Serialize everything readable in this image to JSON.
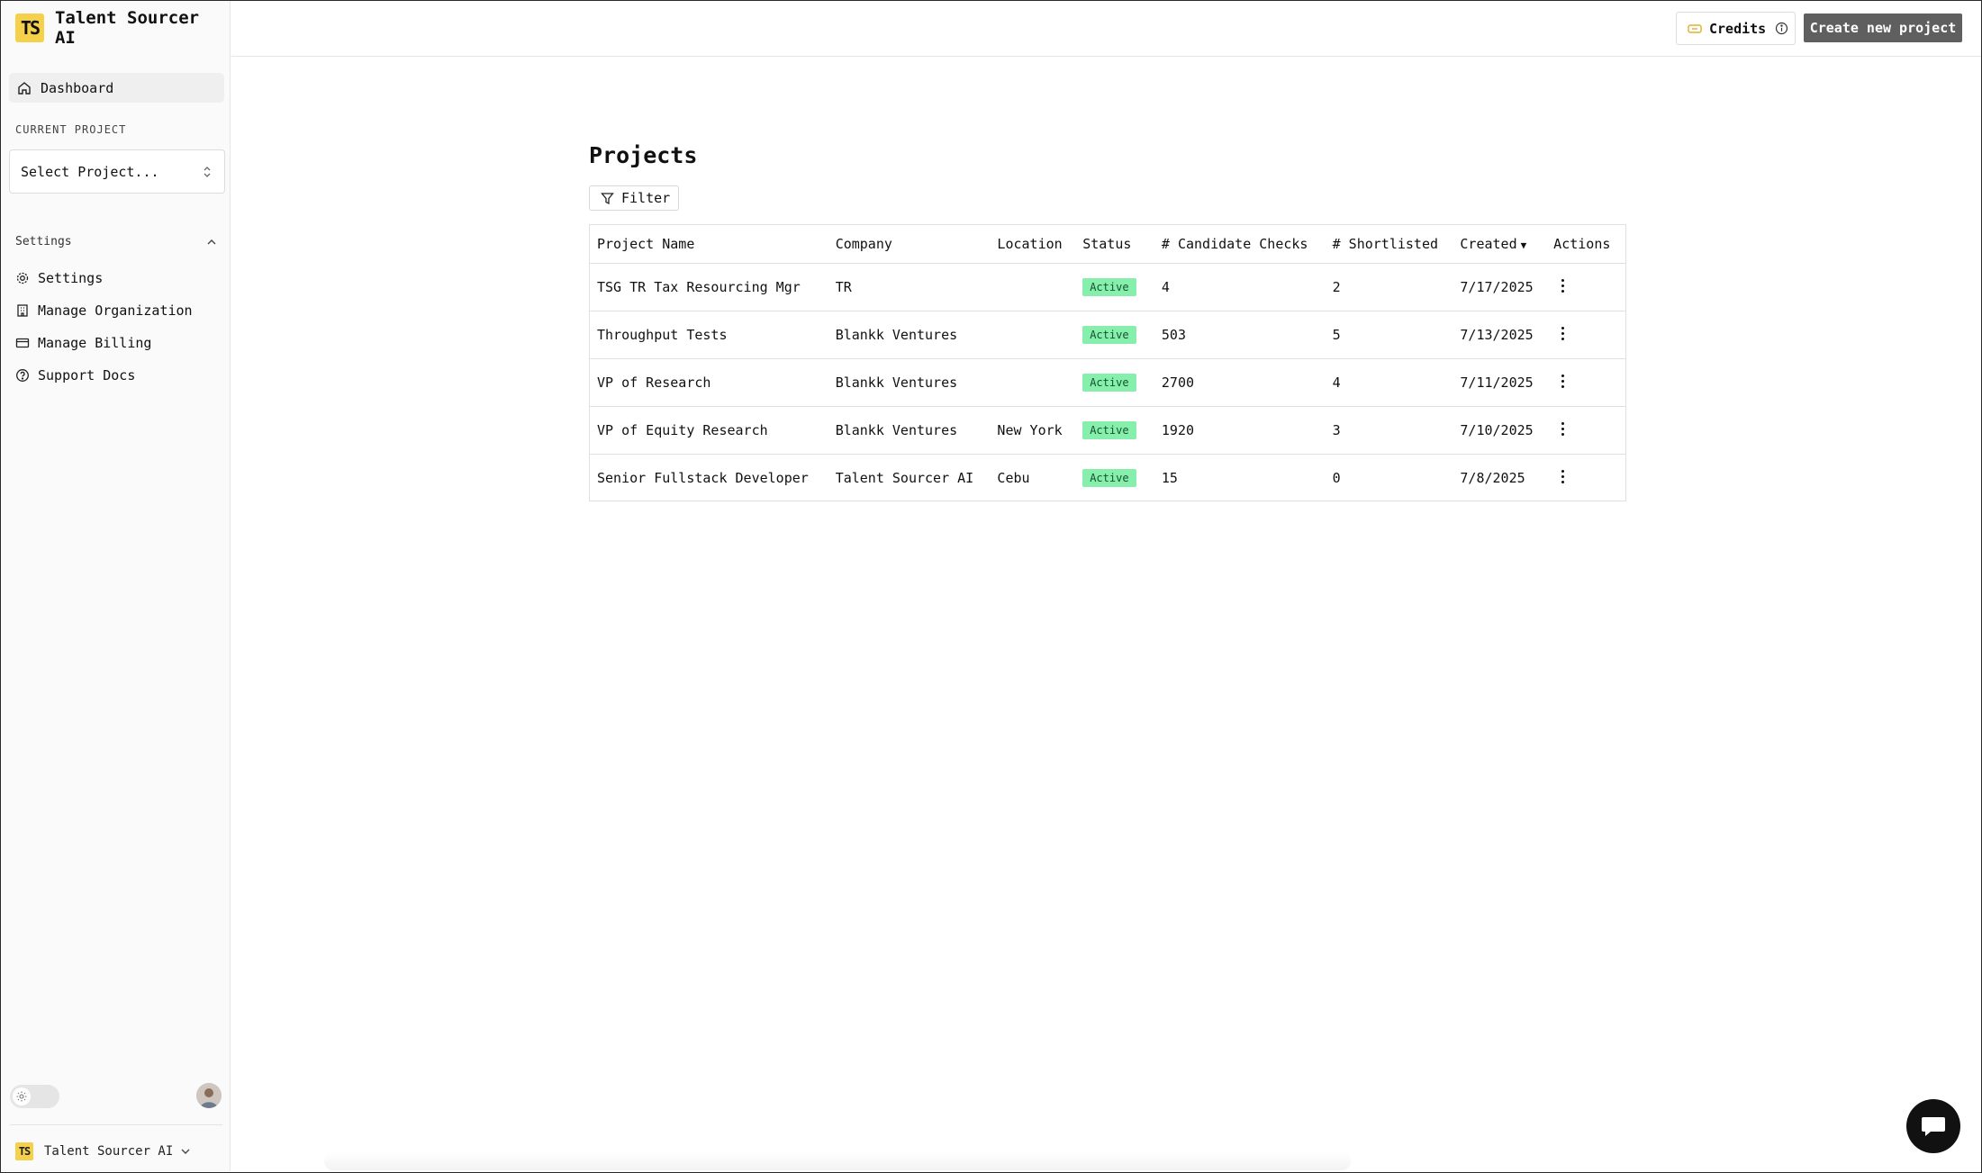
{
  "app": {
    "name": "Talent Sourcer AI",
    "logo_text": "TS"
  },
  "sidebar": {
    "dashboard_label": "Dashboard",
    "current_project_label": "CURRENT PROJECT",
    "project_select_value": "Select Project...",
    "settings_section_label": "Settings",
    "items": [
      {
        "label": "Settings",
        "icon": "gear-icon"
      },
      {
        "label": "Manage Organization",
        "icon": "building-icon"
      },
      {
        "label": "Manage Billing",
        "icon": "credit-card-icon"
      },
      {
        "label": "Support Docs",
        "icon": "help-circle-icon"
      }
    ],
    "org_name": "Talent Sourcer AI"
  },
  "topbar": {
    "credits_label": "Credits",
    "create_label": "Create new project"
  },
  "main": {
    "title": "Projects",
    "filter_label": "Filter",
    "columns": [
      "Project Name",
      "Company",
      "Location",
      "Status",
      "# Candidate Checks",
      "# Shortlisted",
      "Created",
      "Actions"
    ],
    "rows": [
      {
        "name": "TSG TR Tax Resourcing Mgr",
        "company": "TR",
        "location": "",
        "status": "Active",
        "checks": "4",
        "shortlisted": "2",
        "created": "7/17/2025"
      },
      {
        "name": "Throughput Tests",
        "company": "Blankk Ventures",
        "location": "",
        "status": "Active",
        "checks": "503",
        "shortlisted": "5",
        "created": "7/13/2025"
      },
      {
        "name": "VP of Research",
        "company": "Blankk Ventures",
        "location": "",
        "status": "Active",
        "checks": "2700",
        "shortlisted": "4",
        "created": "7/11/2025"
      },
      {
        "name": "VP of Equity Research",
        "company": "Blankk Ventures",
        "location": "New York",
        "status": "Active",
        "checks": "1920",
        "shortlisted": "3",
        "created": "7/10/2025"
      },
      {
        "name": "Senior Fullstack Developer",
        "company": "Talent Sourcer AI",
        "location": "Cebu",
        "status": "Active",
        "checks": "15",
        "shortlisted": "0",
        "created": "7/8/2025"
      }
    ]
  },
  "colors": {
    "brand": "#f5d04a",
    "active_badge": "#86efac",
    "primary_button": "#5f5f5f"
  }
}
